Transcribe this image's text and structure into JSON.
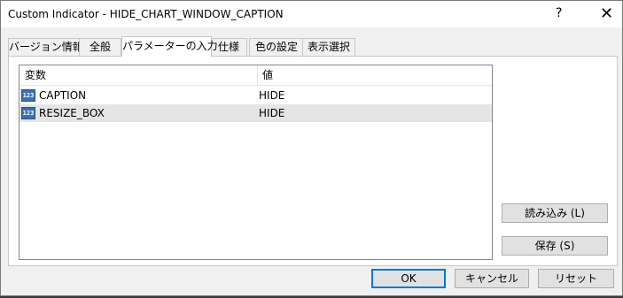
{
  "window": {
    "title": "Custom Indicator - HIDE_CHART_WINDOW_CAPTION",
    "help_label": "?",
    "close_label": "✕"
  },
  "tabs": [
    {
      "label": "バージョン情報",
      "active": false
    },
    {
      "label": "全般",
      "active": false
    },
    {
      "label": "パラメーターの入力",
      "active": true
    },
    {
      "label": "仕様",
      "active": false
    },
    {
      "label": "色の設定",
      "active": false
    },
    {
      "label": "表示選択",
      "active": false
    }
  ],
  "params": {
    "columns": {
      "variable": "変数",
      "value": "値"
    },
    "rows": [
      {
        "icon": "123-icon",
        "icon_text": "123",
        "name": "CAPTION",
        "value": "HIDE",
        "selected": false
      },
      {
        "icon": "123-icon",
        "icon_text": "123",
        "name": "RESIZE_BOX",
        "value": "HIDE",
        "selected": true
      }
    ]
  },
  "side_buttons": {
    "load_label": "読み込み (L)",
    "save_label": "保存 (S)"
  },
  "footer": {
    "ok_label": "OK",
    "cancel_label": "キャンセル",
    "reset_label": "リセット"
  },
  "colors": {
    "default_button_border": "#0078d7",
    "selected_row": "#e5e5e5",
    "icon_fill": "#3b6fb6"
  }
}
